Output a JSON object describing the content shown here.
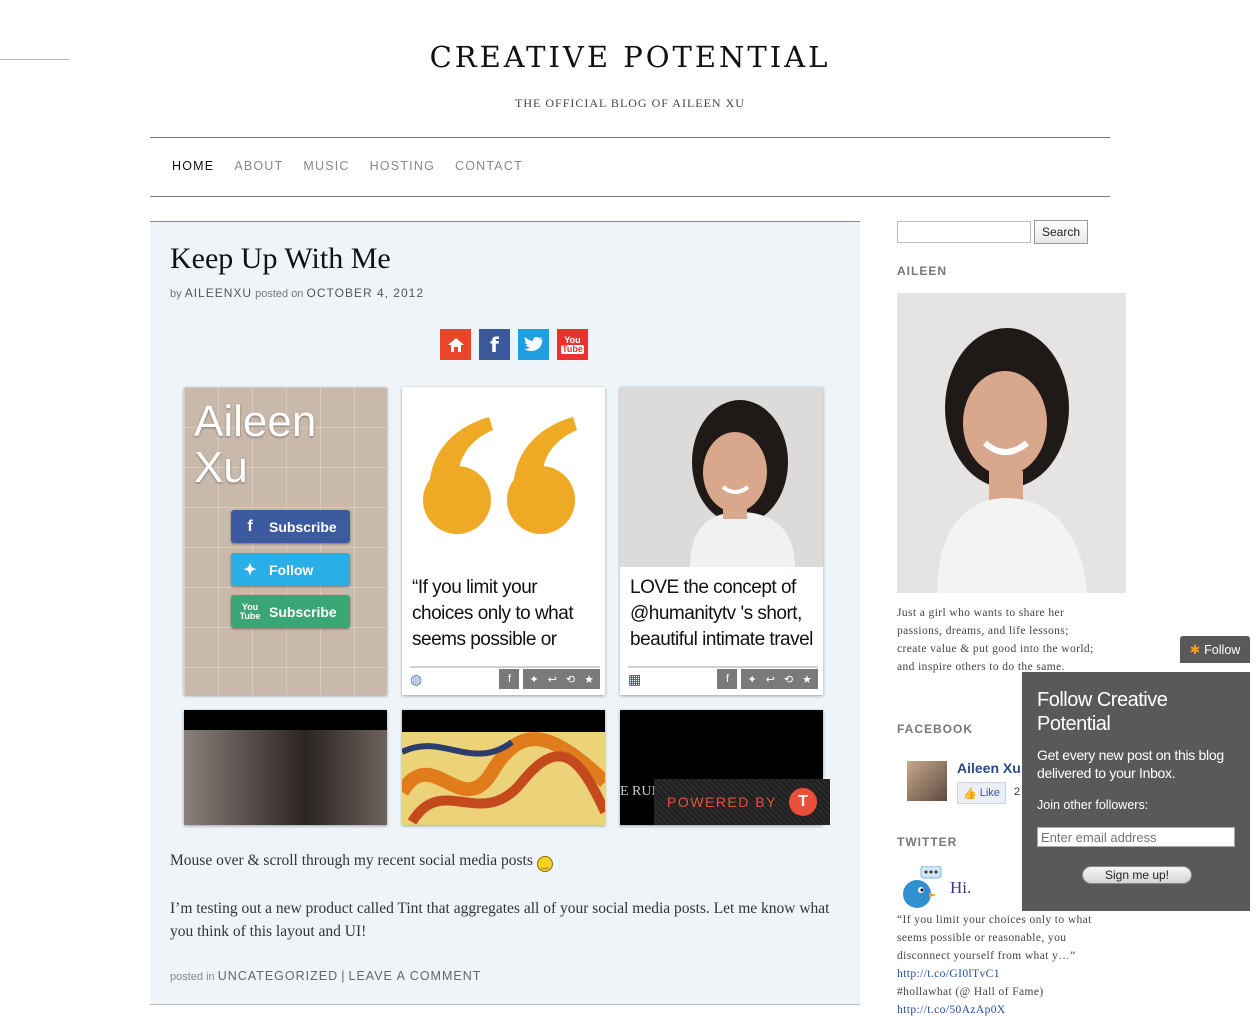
{
  "site": {
    "title": "CREATIVE POTENTIAL",
    "tagline": "THE OFFICIAL BLOG OF AILEEN XU"
  },
  "nav": {
    "items": [
      "HOME",
      "ABOUT",
      "MUSIC",
      "HOSTING",
      "CONTACT"
    ],
    "active": "HOME"
  },
  "post": {
    "title": "Keep Up With Me",
    "by": "by",
    "author": "AILEENXU",
    "posted_on": "posted on",
    "date": "OCTOBER 4, 2012",
    "social_icons": [
      "home-icon",
      "facebook-icon",
      "twitter-icon",
      "youtube-icon"
    ],
    "tiles": {
      "profile": {
        "name": "Aileen Xu",
        "buttons": [
          "Subscribe",
          "Follow",
          "Subscribe"
        ]
      },
      "quote": {
        "text": "“If you limit your choices only to what seems possible or"
      },
      "photo": {
        "text": "LOVE the concept of @humanitytv 's short, beautiful intimate travel"
      },
      "video_partial_text": "E RUN",
      "powered_by": "POWERED BY",
      "powered_logo": "T"
    },
    "body": [
      "Mouse over & scroll through my recent social media posts",
      "I’m testing out a new product called Tint that aggregates all of your social media posts. Let me know what you think of this layout and UI!"
    ],
    "footer": {
      "posted_in": "posted in",
      "category": "UNCATEGORIZED",
      "separator": "|",
      "comment": "LEAVE A COMMENT"
    }
  },
  "sidebar": {
    "search_button": "Search",
    "search_placeholder": "",
    "aileen_title": "AILEEN",
    "bio": "Just a girl who wants to share her passions, dreams, and life lessons; create value & put good into the world; and inspire others to do the same.",
    "facebook_title": "FACEBOOK",
    "fb_name": "Aileen Xu",
    "fb_like": "Like",
    "fb_count": "2",
    "twitter_title": "TWITTER",
    "tw_hi": "Hi.",
    "tweet_text": "“If you limit your choices only to what seems possible or reasonable, you disconnect yourself from what y…”",
    "tweet_link1": "http://t.co/GI0lTvC1",
    "tweet_text2": "#hollawhat (@ Hall of Fame)",
    "tweet_link2": "http://t.co/50AzAp0X"
  },
  "follow": {
    "tab_label": "Follow",
    "title": "Follow Creative Potential",
    "desc": "Get every new post on this blog delivered to your Inbox.",
    "join": "Join other followers:",
    "email_placeholder": "Enter email address",
    "signup": "Sign me up!"
  },
  "colors": {
    "home": "#e8452b",
    "facebook": "#3b5998",
    "twitter": "#1f9ee0",
    "youtube": "#e8322b",
    "quote_mark": "#efaa25",
    "follow_panel": "#595959",
    "post_bg": "#eff4f8"
  }
}
